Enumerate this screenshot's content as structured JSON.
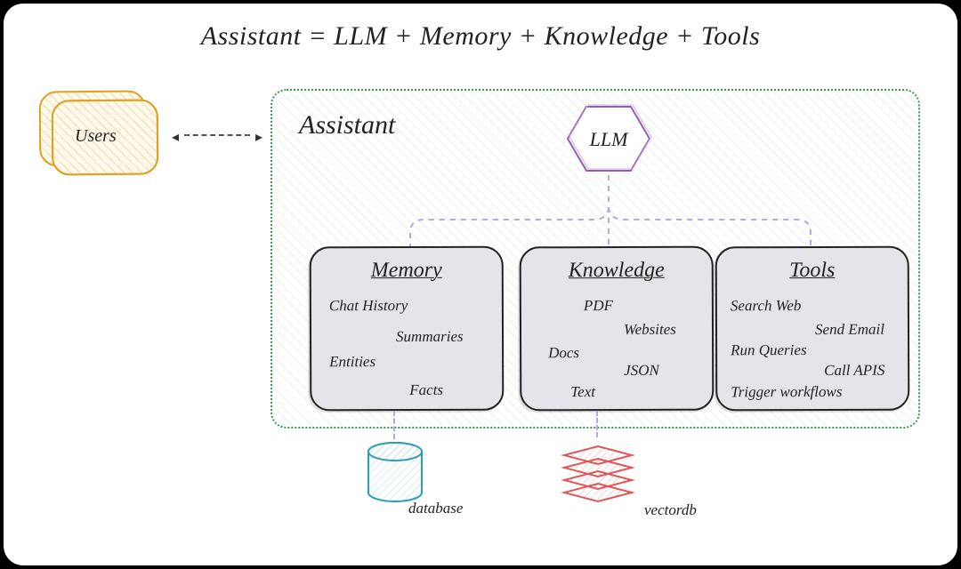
{
  "title": "Assistant = LLM + Memory + Knowledge + Tools",
  "users": {
    "label": "Users"
  },
  "assistant": {
    "label": "Assistant",
    "llm": {
      "label": "LLM"
    },
    "components": {
      "memory": {
        "heading": "Memory",
        "items": [
          "Chat History",
          "Summaries",
          "Entities",
          "Facts"
        ]
      },
      "knowledge": {
        "heading": "Knowledge",
        "items": [
          "PDF",
          "Websites",
          "Docs",
          "JSON",
          "Text"
        ]
      },
      "tools": {
        "heading": "Tools",
        "items": [
          "Search Web",
          "Send Email",
          "Run Queries",
          "Call APIS",
          "Trigger workflows"
        ]
      }
    }
  },
  "storage": {
    "database": {
      "label": "database"
    },
    "vectordb": {
      "label": "vectordb"
    }
  },
  "colors": {
    "users_border": "#e0a020",
    "assistant_border": "#3a9d4d",
    "llm_border": "#9b59b6",
    "connector": "#b7a7e6",
    "db": "#2a9db8",
    "vectordb": "#e05555"
  }
}
